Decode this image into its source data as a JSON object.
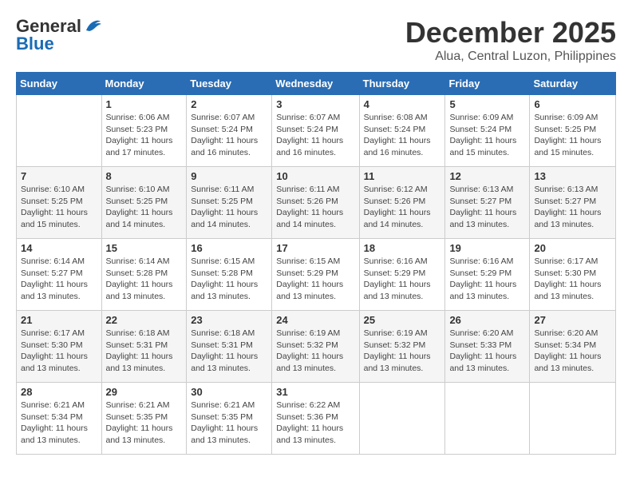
{
  "header": {
    "logo_general": "General",
    "logo_blue": "Blue",
    "month_title": "December 2025",
    "location": "Alua, Central Luzon, Philippines"
  },
  "weekdays": [
    "Sunday",
    "Monday",
    "Tuesday",
    "Wednesday",
    "Thursday",
    "Friday",
    "Saturday"
  ],
  "weeks": [
    [
      {
        "day": "",
        "sunrise": "",
        "sunset": "",
        "daylight": ""
      },
      {
        "day": "1",
        "sunrise": "Sunrise: 6:06 AM",
        "sunset": "Sunset: 5:23 PM",
        "daylight": "Daylight: 11 hours and 17 minutes."
      },
      {
        "day": "2",
        "sunrise": "Sunrise: 6:07 AM",
        "sunset": "Sunset: 5:24 PM",
        "daylight": "Daylight: 11 hours and 16 minutes."
      },
      {
        "day": "3",
        "sunrise": "Sunrise: 6:07 AM",
        "sunset": "Sunset: 5:24 PM",
        "daylight": "Daylight: 11 hours and 16 minutes."
      },
      {
        "day": "4",
        "sunrise": "Sunrise: 6:08 AM",
        "sunset": "Sunset: 5:24 PM",
        "daylight": "Daylight: 11 hours and 16 minutes."
      },
      {
        "day": "5",
        "sunrise": "Sunrise: 6:09 AM",
        "sunset": "Sunset: 5:24 PM",
        "daylight": "Daylight: 11 hours and 15 minutes."
      },
      {
        "day": "6",
        "sunrise": "Sunrise: 6:09 AM",
        "sunset": "Sunset: 5:25 PM",
        "daylight": "Daylight: 11 hours and 15 minutes."
      }
    ],
    [
      {
        "day": "7",
        "sunrise": "Sunrise: 6:10 AM",
        "sunset": "Sunset: 5:25 PM",
        "daylight": "Daylight: 11 hours and 15 minutes."
      },
      {
        "day": "8",
        "sunrise": "Sunrise: 6:10 AM",
        "sunset": "Sunset: 5:25 PM",
        "daylight": "Daylight: 11 hours and 14 minutes."
      },
      {
        "day": "9",
        "sunrise": "Sunrise: 6:11 AM",
        "sunset": "Sunset: 5:25 PM",
        "daylight": "Daylight: 11 hours and 14 minutes."
      },
      {
        "day": "10",
        "sunrise": "Sunrise: 6:11 AM",
        "sunset": "Sunset: 5:26 PM",
        "daylight": "Daylight: 11 hours and 14 minutes."
      },
      {
        "day": "11",
        "sunrise": "Sunrise: 6:12 AM",
        "sunset": "Sunset: 5:26 PM",
        "daylight": "Daylight: 11 hours and 14 minutes."
      },
      {
        "day": "12",
        "sunrise": "Sunrise: 6:13 AM",
        "sunset": "Sunset: 5:27 PM",
        "daylight": "Daylight: 11 hours and 13 minutes."
      },
      {
        "day": "13",
        "sunrise": "Sunrise: 6:13 AM",
        "sunset": "Sunset: 5:27 PM",
        "daylight": "Daylight: 11 hours and 13 minutes."
      }
    ],
    [
      {
        "day": "14",
        "sunrise": "Sunrise: 6:14 AM",
        "sunset": "Sunset: 5:27 PM",
        "daylight": "Daylight: 11 hours and 13 minutes."
      },
      {
        "day": "15",
        "sunrise": "Sunrise: 6:14 AM",
        "sunset": "Sunset: 5:28 PM",
        "daylight": "Daylight: 11 hours and 13 minutes."
      },
      {
        "day": "16",
        "sunrise": "Sunrise: 6:15 AM",
        "sunset": "Sunset: 5:28 PM",
        "daylight": "Daylight: 11 hours and 13 minutes."
      },
      {
        "day": "17",
        "sunrise": "Sunrise: 6:15 AM",
        "sunset": "Sunset: 5:29 PM",
        "daylight": "Daylight: 11 hours and 13 minutes."
      },
      {
        "day": "18",
        "sunrise": "Sunrise: 6:16 AM",
        "sunset": "Sunset: 5:29 PM",
        "daylight": "Daylight: 11 hours and 13 minutes."
      },
      {
        "day": "19",
        "sunrise": "Sunrise: 6:16 AM",
        "sunset": "Sunset: 5:29 PM",
        "daylight": "Daylight: 11 hours and 13 minutes."
      },
      {
        "day": "20",
        "sunrise": "Sunrise: 6:17 AM",
        "sunset": "Sunset: 5:30 PM",
        "daylight": "Daylight: 11 hours and 13 minutes."
      }
    ],
    [
      {
        "day": "21",
        "sunrise": "Sunrise: 6:17 AM",
        "sunset": "Sunset: 5:30 PM",
        "daylight": "Daylight: 11 hours and 13 minutes."
      },
      {
        "day": "22",
        "sunrise": "Sunrise: 6:18 AM",
        "sunset": "Sunset: 5:31 PM",
        "daylight": "Daylight: 11 hours and 13 minutes."
      },
      {
        "day": "23",
        "sunrise": "Sunrise: 6:18 AM",
        "sunset": "Sunset: 5:31 PM",
        "daylight": "Daylight: 11 hours and 13 minutes."
      },
      {
        "day": "24",
        "sunrise": "Sunrise: 6:19 AM",
        "sunset": "Sunset: 5:32 PM",
        "daylight": "Daylight: 11 hours and 13 minutes."
      },
      {
        "day": "25",
        "sunrise": "Sunrise: 6:19 AM",
        "sunset": "Sunset: 5:32 PM",
        "daylight": "Daylight: 11 hours and 13 minutes."
      },
      {
        "day": "26",
        "sunrise": "Sunrise: 6:20 AM",
        "sunset": "Sunset: 5:33 PM",
        "daylight": "Daylight: 11 hours and 13 minutes."
      },
      {
        "day": "27",
        "sunrise": "Sunrise: 6:20 AM",
        "sunset": "Sunset: 5:34 PM",
        "daylight": "Daylight: 11 hours and 13 minutes."
      }
    ],
    [
      {
        "day": "28",
        "sunrise": "Sunrise: 6:21 AM",
        "sunset": "Sunset: 5:34 PM",
        "daylight": "Daylight: 11 hours and 13 minutes."
      },
      {
        "day": "29",
        "sunrise": "Sunrise: 6:21 AM",
        "sunset": "Sunset: 5:35 PM",
        "daylight": "Daylight: 11 hours and 13 minutes."
      },
      {
        "day": "30",
        "sunrise": "Sunrise: 6:21 AM",
        "sunset": "Sunset: 5:35 PM",
        "daylight": "Daylight: 11 hours and 13 minutes."
      },
      {
        "day": "31",
        "sunrise": "Sunrise: 6:22 AM",
        "sunset": "Sunset: 5:36 PM",
        "daylight": "Daylight: 11 hours and 13 minutes."
      },
      {
        "day": "",
        "sunrise": "",
        "sunset": "",
        "daylight": ""
      },
      {
        "day": "",
        "sunrise": "",
        "sunset": "",
        "daylight": ""
      },
      {
        "day": "",
        "sunrise": "",
        "sunset": "",
        "daylight": ""
      }
    ]
  ]
}
